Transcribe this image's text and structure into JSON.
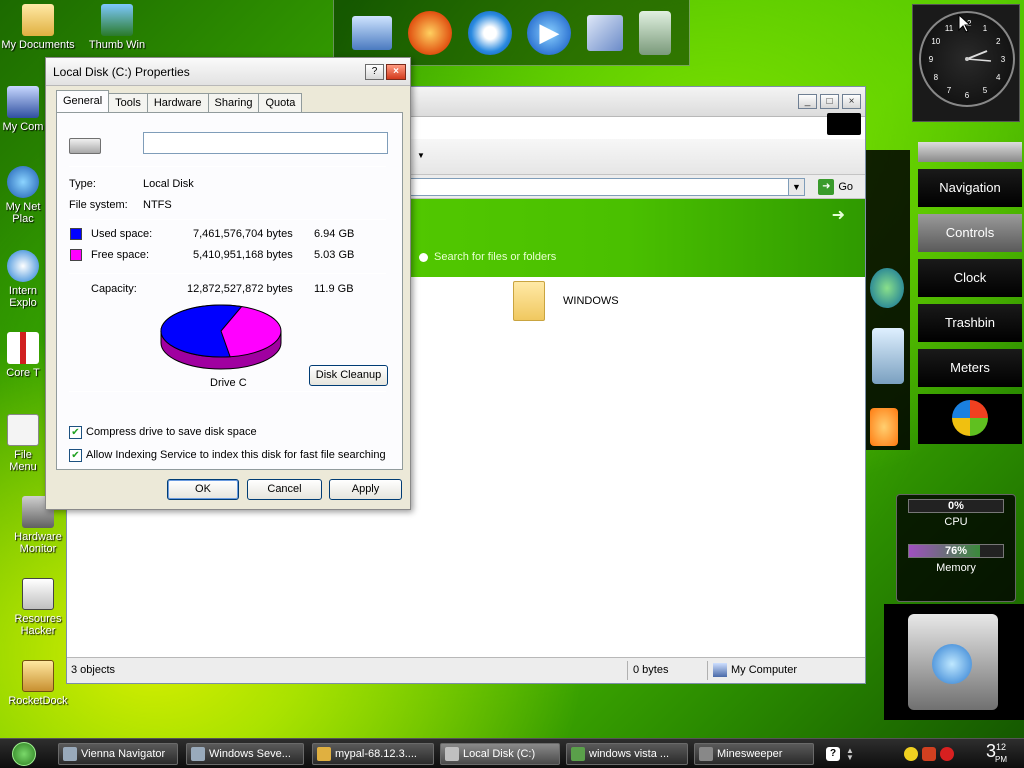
{
  "desktop": {
    "icons": [
      {
        "label": "My Documents"
      },
      {
        "label": "Thumb Win"
      },
      {
        "label": "My Com"
      },
      {
        "label": "My Net Plac"
      },
      {
        "label": "Intern Explo"
      },
      {
        "label": "Core T"
      },
      {
        "label": "File Menu"
      },
      {
        "label": "Hardware Monitor"
      },
      {
        "label": "Resoures Hacker"
      },
      {
        "label": "RocketDock"
      }
    ]
  },
  "dock": {
    "items": [
      "monitor-icon",
      "firefox-icon",
      "internet-explorer-icon",
      "media-player-icon",
      "control-panel-icon",
      "recycle-bin-icon"
    ]
  },
  "explorer": {
    "address_go": "Go",
    "search_hint": "Search for files or folders",
    "folder_name": "WINDOWS",
    "status": {
      "objects": "3 objects",
      "size": "0 bytes",
      "location": "My Computer"
    }
  },
  "dialog": {
    "title": "Local Disk (C:) Properties",
    "help_label": "?",
    "close_label": "×",
    "tabs": [
      "General",
      "Tools",
      "Hardware",
      "Sharing",
      "Quota"
    ],
    "name_value": "",
    "type_label": "Type:",
    "type_value": "Local Disk",
    "fs_label": "File system:",
    "fs_value": "NTFS",
    "used_label": "Used space:",
    "used_bytes": "7,461,576,704 bytes",
    "used_gb": "6.94 GB",
    "free_label": "Free space:",
    "free_bytes": "5,410,951,168 bytes",
    "free_gb": "5.03 GB",
    "capacity_label": "Capacity:",
    "capacity_bytes": "12,872,527,872 bytes",
    "capacity_gb": "11.9 GB",
    "used_fraction": 0.58,
    "drive_label": "Drive C",
    "cleanup_label": "Disk Cleanup",
    "compress_label": "Compress drive to save disk space",
    "compress_checked": true,
    "index_label": "Allow Indexing Service to index this disk for fast file searching",
    "index_checked": true,
    "ok_label": "OK",
    "cancel_label": "Cancel",
    "apply_label": "Apply",
    "colors": {
      "used": "#0000ff",
      "free": "#ff00ff"
    }
  },
  "sidebar": {
    "clock_numbers": [
      "12",
      "1",
      "2",
      "3",
      "4",
      "5",
      "6",
      "7",
      "8",
      "9",
      "10",
      "11"
    ],
    "menu": [
      {
        "label": "Navigation",
        "active": false
      },
      {
        "label": "Controls",
        "active": true
      },
      {
        "label": "Clock",
        "active": false
      },
      {
        "label": "Trashbin",
        "active": false
      },
      {
        "label": "Meters",
        "active": false
      }
    ],
    "cpu_value": "0%",
    "cpu_label": "CPU",
    "cpu_level": 0,
    "memory_value": "76%",
    "memory_label": "Memory",
    "memory_level": 0.76
  },
  "taskbar": {
    "tasks": [
      {
        "label": "Vienna Navigator",
        "active": false
      },
      {
        "label": "Windows Seve...",
        "active": false
      },
      {
        "label": "mypal-68.12.3....",
        "active": false
      },
      {
        "label": "Local Disk (C:)",
        "active": true
      },
      {
        "label": "windows vista ...",
        "active": false
      },
      {
        "label": "Minesweeper",
        "active": false
      }
    ],
    "time_hour": "3",
    "time_min": "12",
    "time_ampm": "PM"
  }
}
